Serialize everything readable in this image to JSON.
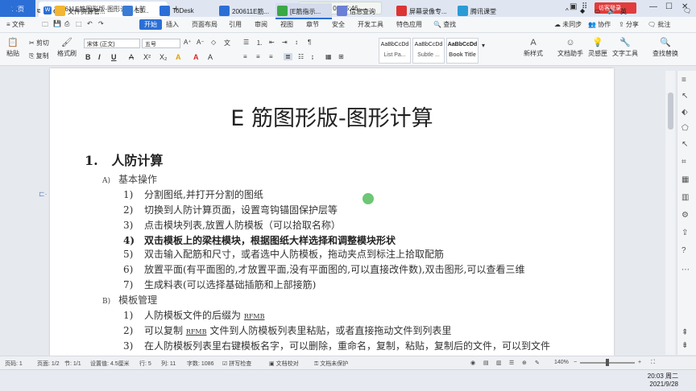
{
  "titlebar": {
    "home_tab": "首页",
    "doc_tab": "200611E筋图形版-图形计算人防",
    "meeting": "上课中 00:05:46",
    "login": "访客登录"
  },
  "menu": {
    "file": "文件",
    "items": [
      "开始",
      "插入",
      "页面布局",
      "引用",
      "审阅",
      "视图",
      "章节",
      "安全",
      "开发工具",
      "特色应用"
    ],
    "search": "查找",
    "sync": "未同步",
    "collab": "协作",
    "share": "分享",
    "comment": "批注"
  },
  "ribbon": {
    "paste": "粘贴",
    "cut": "剪切",
    "copy": "复制",
    "format_painter": "格式刷",
    "font_name": "宋体 (正文)",
    "font_size": "五号",
    "styles": [
      {
        "preview": "AaBbCcDd",
        "label": "List Pa..."
      },
      {
        "preview": "AaBbCcDd",
        "label": "Subtle ..."
      },
      {
        "preview": "AaBbCcDd",
        "label": "Book Title"
      }
    ],
    "new_style": "新样式",
    "assistant": "文档助手",
    "inspiration": "灵感匣",
    "text_tools": "文字工具",
    "find_replace": "查找替换"
  },
  "document": {
    "title": "E 筋图形版-图形计算",
    "h1_num": "1.",
    "h1": "人防计算",
    "sections": [
      {
        "marker": "A)",
        "title": "基本操作",
        "items": [
          {
            "num": "1)",
            "text": "分割图纸,并打开分割的图纸",
            "bold": false
          },
          {
            "num": "2)",
            "text": "切换到人防计算页面，设置弯钩锚固保护层等",
            "bold": false
          },
          {
            "num": "3)",
            "text": "点击模块列表,放置人防模板（可以拾取名称）",
            "bold": false
          },
          {
            "num": "4)",
            "text": "双击模板上的梁柱模块，根据图纸大样选择和调整模块形状",
            "bold": true
          },
          {
            "num": "5)",
            "text": "双击输入配筋和尺寸，或者选中人防模板，拖动夹点到标注上拾取配筋",
            "bold": false
          },
          {
            "num": "6)",
            "text": "放置平面(有平面图的,才放置平面,没有平面图的,可以直接改件数),双击图形,可以查看三维",
            "bold": false
          },
          {
            "num": "7)",
            "text": "生成料表(可以选择基础插筋和上部接筋)",
            "bold": false
          }
        ]
      },
      {
        "marker": "B)",
        "title": "模板管理",
        "items": [
          {
            "num": "1)",
            "text": "人防模板文件的后缀为",
            "tag": "RFMB"
          },
          {
            "num": "2)",
            "text_pre": "可以复制",
            "tag": "RFMB",
            "text_post": "文件到人防模板列表里粘贴，或者直接拖动文件到列表里"
          },
          {
            "num": "3)",
            "text": "在人防模板列表里右键模板名字，可以删除，重命名，复制，粘贴，复制后的文件，可以到文件"
          }
        ]
      }
    ]
  },
  "status": {
    "page": "页码: 1",
    "pages": "页面: 1/2",
    "section": "节: 1/1",
    "setting": "设置值: 4.5厘米",
    "row": "行: 5",
    "col": "列: 11",
    "words": "字数: 1086",
    "spell": "拼写检查",
    "proof": "文档校对",
    "protect": "文档未保护",
    "zoom": "140%"
  },
  "taskbar": {
    "apps": [
      {
        "label": "文件资源管...",
        "color": "#f2b632"
      },
      {
        "label": "E3...",
        "color": "#3a7bd5"
      },
      {
        "label": "ToDesk",
        "color": "#2b6fd6"
      },
      {
        "label": "200611E筋...",
        "color": "#2b6fd6"
      },
      {
        "label": "[E筋指示...",
        "color": "#3aa845"
      },
      {
        "label": "信息查询",
        "color": "#6b7fd6"
      },
      {
        "label": "屏幕录像专...",
        "color": "#d33"
      },
      {
        "label": "腾讯课堂",
        "color": "#2b9bd6"
      }
    ],
    "time": "20:03 周二",
    "date": "2021/9/28"
  }
}
